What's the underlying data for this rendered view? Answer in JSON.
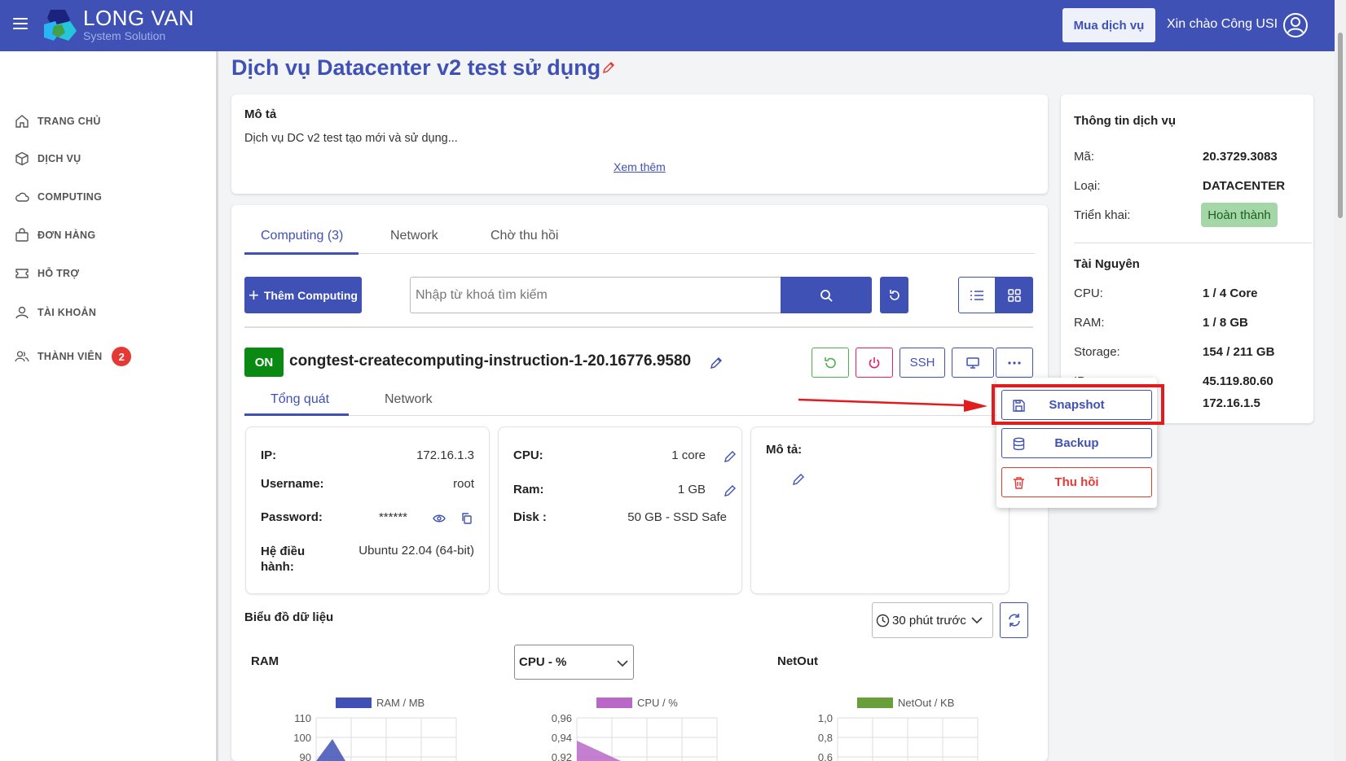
{
  "header": {
    "brand_name": "LONG VAN",
    "brand_sub": "System Solution",
    "buy_label": "Mua dịch vụ",
    "greeting": "Xin chào Công USI"
  },
  "sidebar": {
    "items": [
      {
        "label": "TRANG CHỦ",
        "icon": "home-icon"
      },
      {
        "label": "DỊCH VỤ",
        "icon": "cube-icon"
      },
      {
        "label": "COMPUTING",
        "icon": "cloud-icon"
      },
      {
        "label": "ĐƠN HÀNG",
        "icon": "bag-icon"
      },
      {
        "label": "HỖ TRỢ",
        "icon": "ticket-icon"
      },
      {
        "label": "TÀI KHOẢN",
        "icon": "user-icon"
      },
      {
        "label": "THÀNH VIÊN",
        "icon": "users-icon",
        "badge": "2"
      }
    ]
  },
  "page": {
    "title": "Dịch vụ Datacenter v2 test sử dụng"
  },
  "description": {
    "title": "Mô tả",
    "text": "Dịch vụ DC v2 test tạo mới và sử dụng...",
    "more_link": "Xem thêm"
  },
  "tabs": {
    "computing": "Computing (3)",
    "network": "Network",
    "pending": "Chờ thu hồi"
  },
  "toolbar": {
    "add_label": "Thêm Computing",
    "search_placeholder": "Nhập từ khoá tìm kiếm"
  },
  "computing": {
    "status": "ON",
    "name": "congtest-createcomputing-instruction-1-20.16776.9580",
    "ssh_label": "SSH",
    "subtabs": {
      "overview": "Tổng quát",
      "network": "Network"
    },
    "conn": {
      "ip_label": "IP:",
      "ip": "172.16.1.3",
      "user_label": "Username:",
      "user": "root",
      "pass_label": "Password:",
      "pass": "******",
      "os_label": "Hệ điều hành:",
      "os": "Ubuntu 22.04 (64-bit)"
    },
    "hw": {
      "cpu_label": "CPU:",
      "cpu": "1 core",
      "ram_label": "Ram:",
      "ram": "1 GB",
      "disk_label": "Disk :",
      "disk": "50 GB - SSD Safe"
    },
    "note_label": "Mô tả:"
  },
  "charts_section": {
    "title": "Biểu đồ dữ liệu",
    "time_range": "30 phút trước",
    "ram_title": "RAM",
    "cpu_select": "CPU - %",
    "netout_title": "NetOut"
  },
  "chart_data": [
    {
      "type": "area",
      "series": [
        {
          "name": "RAM / MB",
          "color": "#3f51b5"
        }
      ],
      "y_ticks": [
        "110",
        "100",
        "90"
      ]
    },
    {
      "type": "area",
      "series": [
        {
          "name": "CPU / %",
          "color": "#ba68c8"
        }
      ],
      "y_ticks": [
        "0,96",
        "0,94",
        "0,92"
      ]
    },
    {
      "type": "line",
      "series": [
        {
          "name": "NetOut / KB",
          "color": "#689f38"
        }
      ],
      "y_ticks": [
        "1,0",
        "0,8",
        "0,6"
      ]
    }
  ],
  "service_info": {
    "title": "Thông tin dịch vụ",
    "code_label": "Mã:",
    "code": "20.3729.3083",
    "type_label": "Loại:",
    "type": "DATACENTER",
    "deploy_label": "Triển khai:",
    "deploy": "Hoàn thành",
    "res_title": "Tài Nguyên",
    "cpu_label": "CPU:",
    "cpu": "1 / 4 Core",
    "ram_label": "RAM:",
    "ram": "1 / 8 GB",
    "storage_label": "Storage:",
    "storage": "154 / 211 GB",
    "ip_label": "IP:",
    "ip_public": "45.119.80.60",
    "ip_private": "172.16.1.5"
  },
  "dropdown": {
    "snapshot": "Snapshot",
    "backup": "Backup",
    "revoke": "Thu hồi"
  },
  "colors": {
    "primary": "#3f51b5",
    "success": "#0a8a12",
    "danger": "#e53935"
  }
}
